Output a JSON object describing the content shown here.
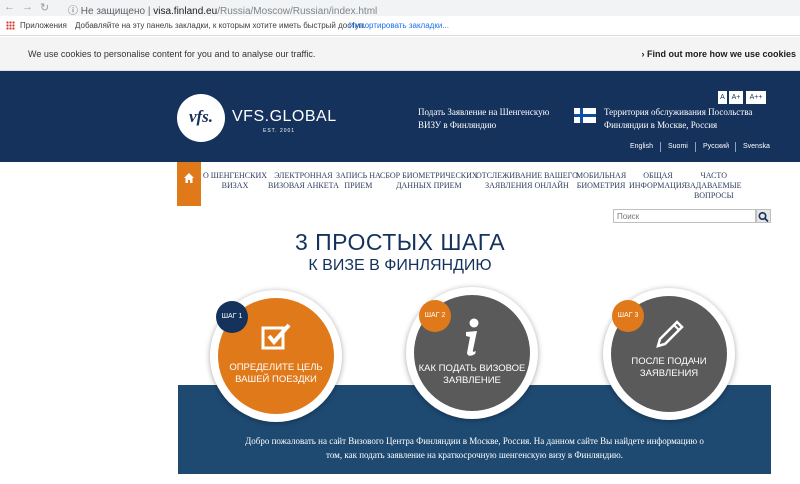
{
  "browser": {
    "not_secure": "Не защищено",
    "url_host": "visa.finland.eu",
    "url_path": "/Russia/Moscow/Russian/index.html",
    "apps_label": "Приложения",
    "bookmarks_hint": "Добавляйте на эту панель закладки, к которым хотите иметь быстрый доступ.",
    "import_link": "Импортировать закладки..."
  },
  "cookie": {
    "text": "We use cookies to personalise content for you and to analyse our traffic.",
    "link": "Find out more how we use cookies"
  },
  "header": {
    "logo_text": "vfs.",
    "brand": "VFS.GLOBAL",
    "est": "EST. 2001",
    "apply_line1": "Подать Заявление на Шенгенскую",
    "apply_line2": "ВИЗУ в Финляндию",
    "territory_line1": "Территория обслуживания Посольства",
    "territory_line2": "Финляндии в Москве, Россия",
    "font_sizes": [
      "A",
      "A+",
      "A++"
    ],
    "languages": [
      "English",
      "Suomi",
      "Русский",
      "Svenska"
    ]
  },
  "nav": {
    "items": [
      {
        "line1": "О ШЕНГЕНСКИХ",
        "line2": "ВИЗАХ",
        "line3": ""
      },
      {
        "line1": "ЭЛЕКТРОННАЯ",
        "line2": "ВИЗОВАЯ АНКЕТА",
        "line3": ""
      },
      {
        "line1": "ЗАПИСЬ НА",
        "line2": "ПРИЕМ",
        "line3": ""
      },
      {
        "line1": "СБОР БИОМЕТРИЧЕСКИХ",
        "line2": "ДАННЫХ ПРИЕМ",
        "line3": ""
      },
      {
        "line1": "ОТСЛЕЖИВАНИЕ ВАШЕГО",
        "line2": "ЗАЯВЛЕНИЯ ОНЛАЙН",
        "line3": ""
      },
      {
        "line1": "МОБИЛЬНАЯ",
        "line2": "БИОМЕТРИЯ",
        "line3": ""
      },
      {
        "line1": "ОБЩАЯ",
        "line2": "ИНФОРМАЦИЯ",
        "line3": ""
      },
      {
        "line1": "ЧАСТО",
        "line2": "ЗАДАВАЕМЫЕ",
        "line3": "ВОПРОСЫ"
      }
    ]
  },
  "search": {
    "placeholder": "Поиск"
  },
  "main": {
    "title": "3 ПРОСТЫХ ШАГА",
    "subtitle": "К ВИЗЕ В ФИНЛЯНДИЮ",
    "steps": [
      {
        "badge": "ШАГ 1",
        "line1": "ОПРЕДЕЛИТЕ ЦЕЛЬ",
        "line2": "ВАШЕЙ ПОЕЗДКИ",
        "icon": "checkbox-icon"
      },
      {
        "badge": "ШАГ 2",
        "line1": "КАК ПОДАТЬ ВИЗОВОЕ",
        "line2": "ЗАЯВЛЕНИЕ",
        "icon": "info-icon"
      },
      {
        "badge": "ШАГ 3",
        "line1": "ПОСЛЕ ПОДАЧИ",
        "line2": "ЗАЯВЛЕНИЯ",
        "icon": "pencil-icon"
      }
    ],
    "welcome_line1": "Добро пожаловать на сайт Визового Центра Финляндии в Москве, Россия. На данном сайте Вы найдете информацию о",
    "welcome_line2": "том, как подать заявление на краткосрочную шенгенскую визу в Финляндию."
  },
  "colors": {
    "header_bg": "#14325c",
    "accent_orange": "#e0791a",
    "step_gray": "#5a5a5a",
    "welcome_bg": "#1e4a72"
  }
}
